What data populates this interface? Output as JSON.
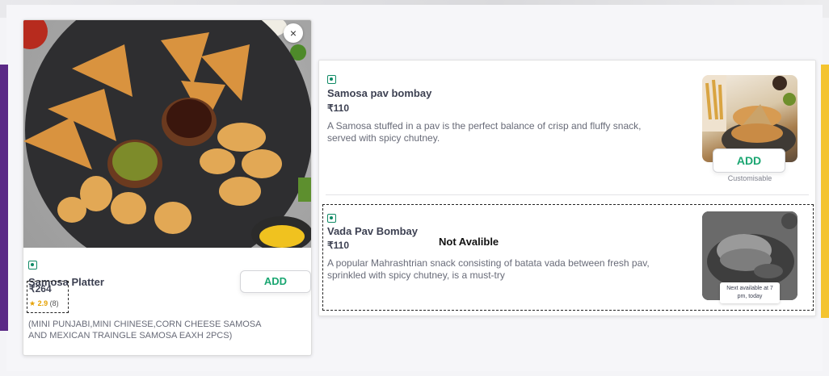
{
  "left_card": {
    "close_glyph": "×",
    "name": "Samosa Platter",
    "price": "₹264",
    "rating_star": "★",
    "rating_value": "2.9",
    "rating_count": "(8)",
    "add_label": "ADD",
    "description": "(MINI PUNJABI,MINI CHINESE,CORN CHEESE SAMOSA AND MEXICAN TRAINGLE SAMOSA EAXH 2PCS)"
  },
  "items": [
    {
      "name": "Samosa pav bombay",
      "price": "₹110",
      "description": "A Samosa stuffed in a pav is the perfect balance of crisp and fluffy snack, served with spicy chutney.",
      "add_label": "ADD",
      "customisable": "Customisable"
    },
    {
      "name": "Vada Pav Bombay",
      "price": "₹110",
      "status": "Not Avalible",
      "description": "A popular Mahrashtrian snack consisting of batata vada between fresh pav, sprinkled with spicy chutney, is a must-try",
      "next_available": "Next available at 7 pm, today"
    }
  ],
  "colors": {
    "veg_green": "#0f8a65",
    "add_green": "#1ba672",
    "rating_gold": "#e5a100",
    "side_purple": "#5b2a86",
    "side_yellow": "#f4c430"
  },
  "icons": {
    "veg": "veg-indicator-icon",
    "close": "close-icon",
    "star": "star-icon"
  }
}
